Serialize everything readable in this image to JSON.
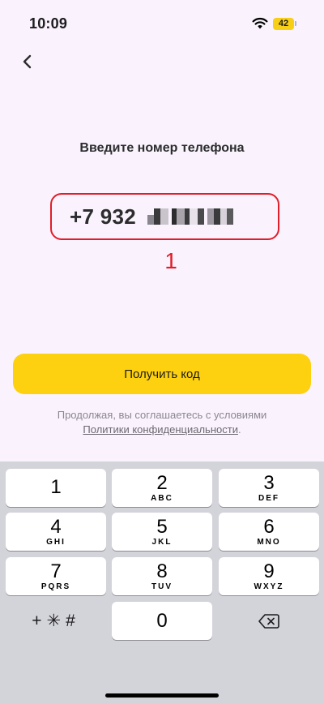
{
  "status_bar": {
    "time": "10:09",
    "battery_level": "42"
  },
  "nav": {
    "back_icon": "chevron-left-icon"
  },
  "title": "Введите номер телефона",
  "phone_field": {
    "value_visible": "+7 932"
  },
  "annotation": "1",
  "get_code_button": "Получить код",
  "terms": {
    "line1": "Продолжая, вы соглашаетесь с условиями",
    "link": "Политики конфиденциальности",
    "suffix": "."
  },
  "keypad": {
    "keys": [
      {
        "digit": "1",
        "letters": ""
      },
      {
        "digit": "2",
        "letters": "ABC"
      },
      {
        "digit": "3",
        "letters": "DEF"
      },
      {
        "digit": "4",
        "letters": "GHI"
      },
      {
        "digit": "5",
        "letters": "JKL"
      },
      {
        "digit": "6",
        "letters": "MNO"
      },
      {
        "digit": "7",
        "letters": "PQRS"
      },
      {
        "digit": "8",
        "letters": "TUV"
      },
      {
        "digit": "9",
        "letters": "WXYZ"
      }
    ],
    "zero": "0",
    "symbols": "+✳#",
    "delete_icon": "backspace-icon"
  },
  "colors": {
    "accent_yellow": "#fdd10f",
    "annotation_red": "#e11d2a",
    "background": "#faf3fd"
  }
}
